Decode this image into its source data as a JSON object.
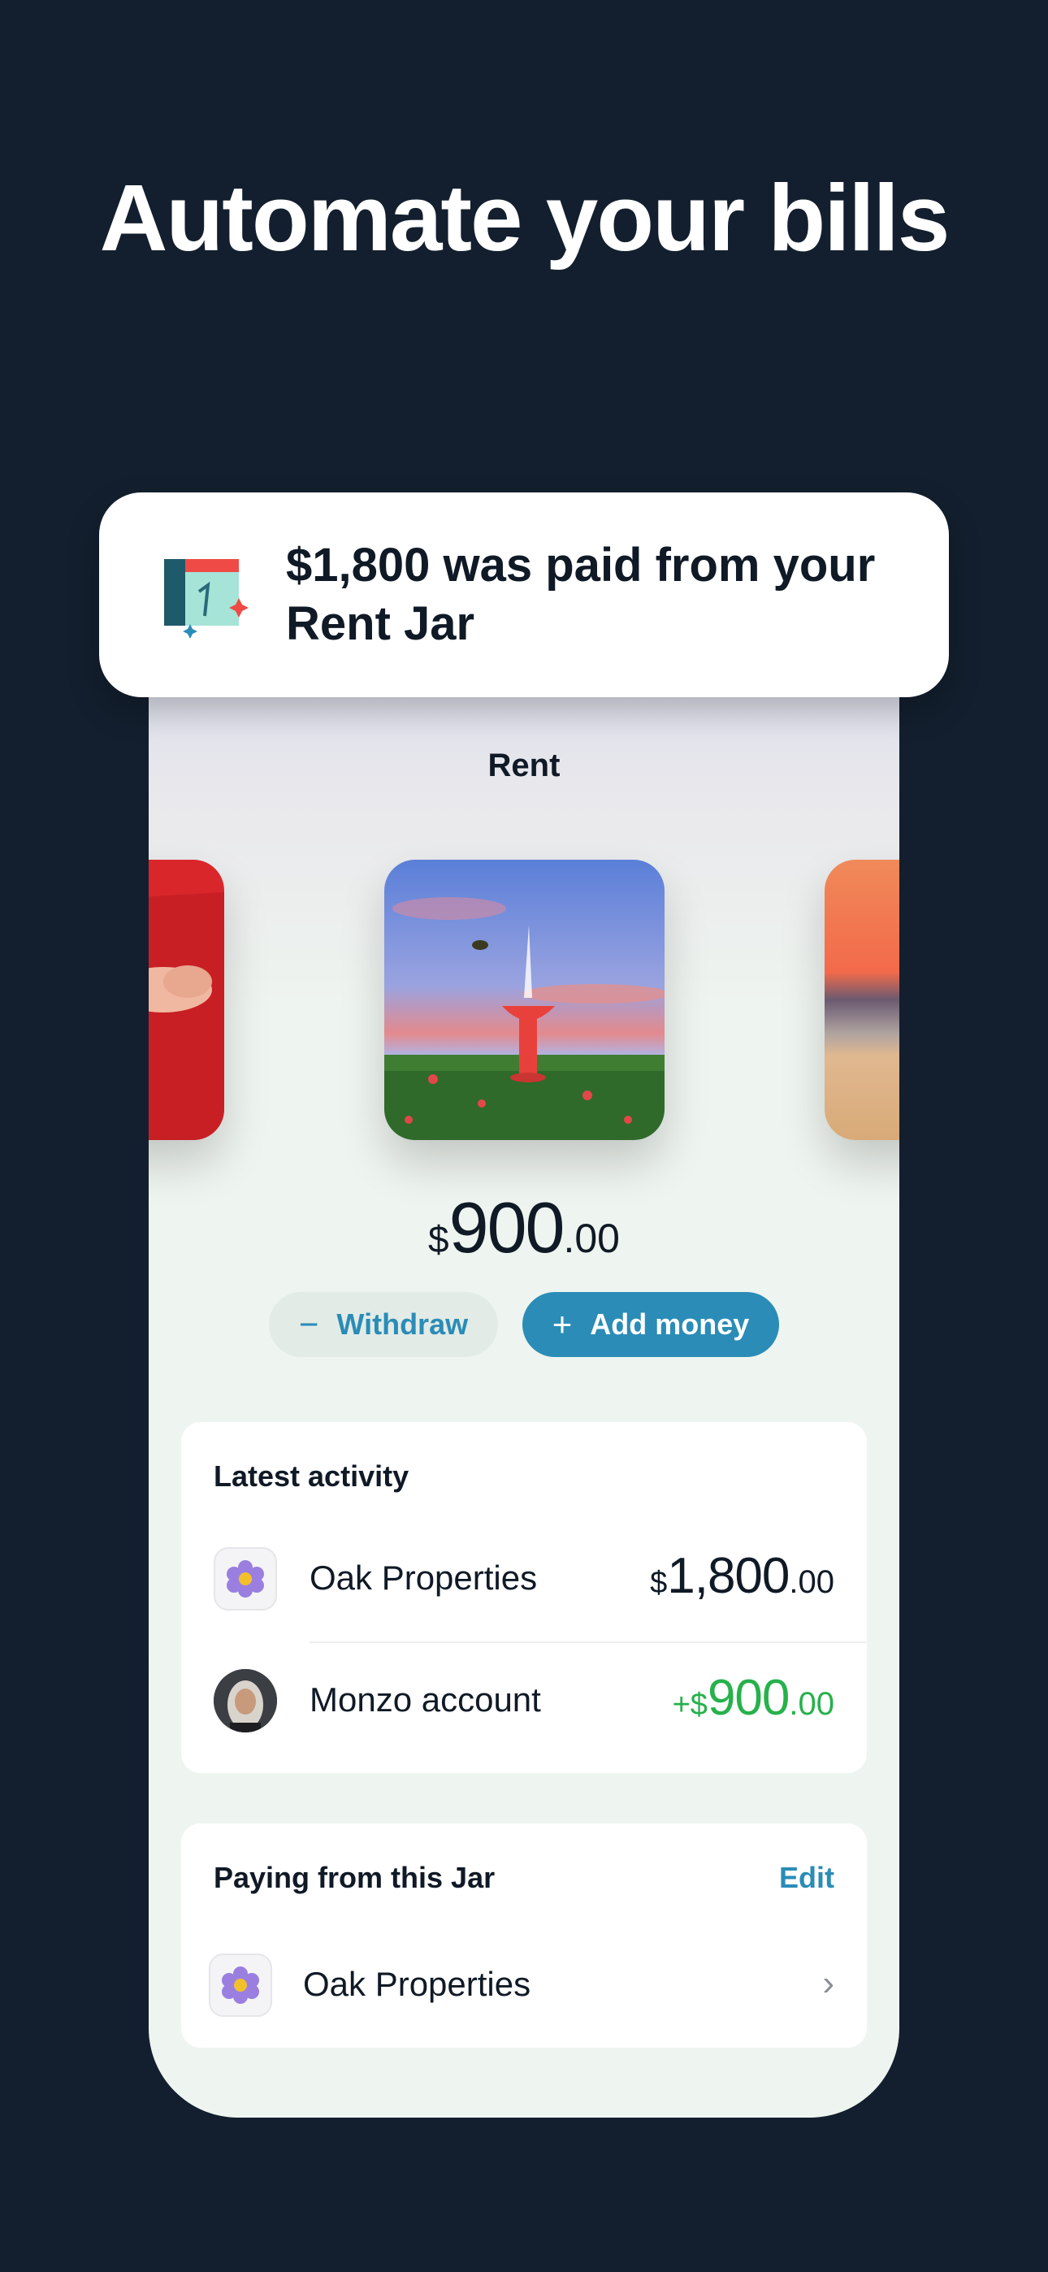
{
  "headline": "Automate your bills",
  "notification": {
    "text": "$1,800 was paid from your Rent Jar",
    "icon": "calendar-icon"
  },
  "jar": {
    "title": "Rent",
    "balance": {
      "currency": "$",
      "main": "900",
      "cents": ".00"
    },
    "withdraw_label": "Withdraw",
    "add_money_label": "Add money"
  },
  "latest_activity": {
    "title": "Latest activity",
    "items": [
      {
        "name": "Oak Properties",
        "currency": "$",
        "main": "1,800",
        "cents": ".00",
        "icon": "flower-icon"
      },
      {
        "name": "Monzo account",
        "currency": "+$",
        "main": "900",
        "cents": ".00",
        "icon": "user-avatar",
        "positive_color": "#27b14b"
      }
    ]
  },
  "paying_from": {
    "title": "Paying from this Jar",
    "edit_label": "Edit",
    "items": [
      {
        "name": "Oak Properties",
        "icon": "flower-icon"
      }
    ]
  },
  "colors": {
    "background": "#131f2e",
    "accent": "#2a8cb7",
    "positive": "#27b14b"
  }
}
